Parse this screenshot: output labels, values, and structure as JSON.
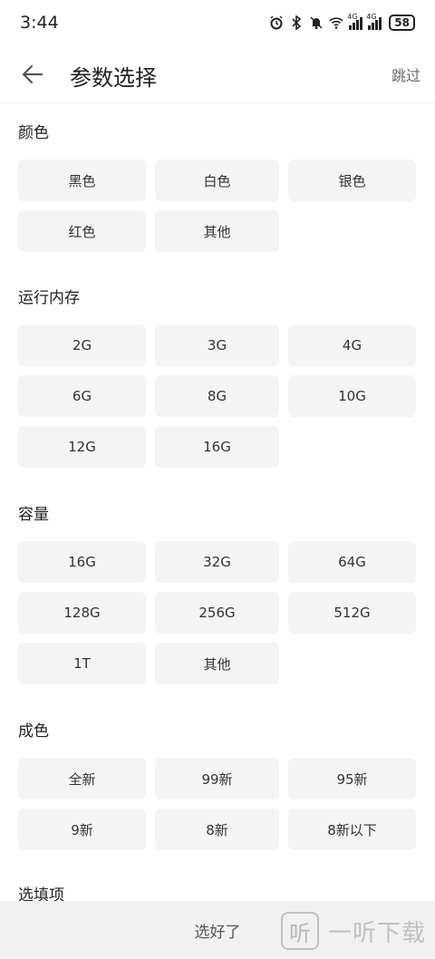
{
  "status": {
    "time": "3:44",
    "signal_1": "4G",
    "signal_2": "4G",
    "battery": "58"
  },
  "header": {
    "title": "参数选择",
    "skip_label": "跳过"
  },
  "sections": [
    {
      "title": "颜色",
      "options": [
        "黑色",
        "白色",
        "银色",
        "红色",
        "其他"
      ]
    },
    {
      "title": "运行内存",
      "options": [
        "2G",
        "3G",
        "4G",
        "6G",
        "8G",
        "10G",
        "12G",
        "16G"
      ]
    },
    {
      "title": "容量",
      "options": [
        "16G",
        "32G",
        "64G",
        "128G",
        "256G",
        "512G",
        "1T",
        "其他"
      ]
    },
    {
      "title": "成色",
      "options": [
        "全新",
        "99新",
        "95新",
        "9新",
        "8新",
        "8新以下"
      ]
    },
    {
      "title": "选填项",
      "options": []
    }
  ],
  "footer": {
    "done_label": "选好了"
  },
  "watermark": {
    "logo_glyph": "听",
    "text": "一听下载"
  },
  "colors": {
    "option_bg": "#f4f4f4",
    "footer_bg": "#f1f1f1",
    "text": "#222222"
  },
  "icons": {
    "back": "arrow-left-icon",
    "alarm": "alarm-icon",
    "bluetooth": "bluetooth-icon",
    "mute": "bell-off-icon",
    "wifi": "wifi-icon"
  }
}
